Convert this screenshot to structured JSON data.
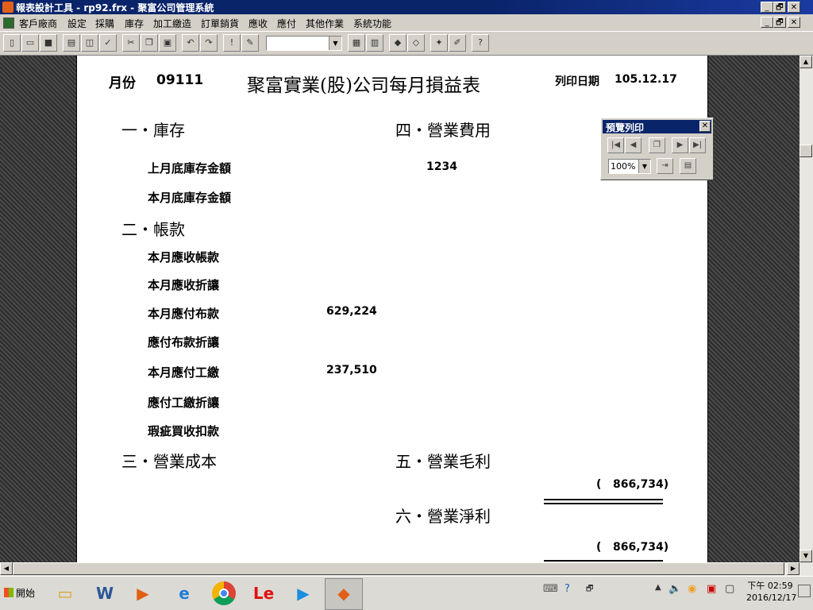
{
  "window": {
    "title": "報表設計工具 - rp92.frx - 聚富公司管理系統",
    "minimize": "_",
    "restore": "🗗",
    "close": "✕"
  },
  "menu": [
    "客戶廠商",
    "設定",
    "採購",
    "庫存",
    "加工繳造",
    "訂單銷貨",
    "應收",
    "應付",
    "其他作業",
    "系統功能"
  ],
  "report": {
    "month_label": "月份",
    "month_value": "09111",
    "title": "聚富實業(股)公司每月損益表",
    "print_date_label": "列印日期",
    "print_date_value": "105.12.17",
    "sections": {
      "inventory": "一・庫存",
      "accounts": "二・帳款",
      "cost": "三・營業成本",
      "expense": "四・營業費用",
      "gross": "五・營業毛利",
      "net": "六・營業淨利"
    },
    "items": {
      "last_inventory": "上月底庫存金額",
      "this_inventory": "本月底庫存金額",
      "receivable": "本月應收帳款",
      "receivable_discount": "本月應收折讓",
      "payable_cloth": "本月應付布款",
      "payable_cloth_discount": "應付布款折讓",
      "payable_labor": "本月應付工繳",
      "payable_labor_discount": "應付工繳折讓",
      "defect_deduction": "瑕疵買收扣款"
    },
    "values": {
      "expense": "1234",
      "payable_cloth": "629,224",
      "payable_labor": "237,510",
      "gross": "(   866,734)",
      "net": "(   866,734)"
    }
  },
  "preview_toolbar": {
    "title": "預覽列印",
    "zoom": "100%"
  },
  "taskbar": {
    "start": "開始",
    "clock_time": "下午 02:59",
    "clock_date": "2016/12/17",
    "le_label": "Le"
  }
}
